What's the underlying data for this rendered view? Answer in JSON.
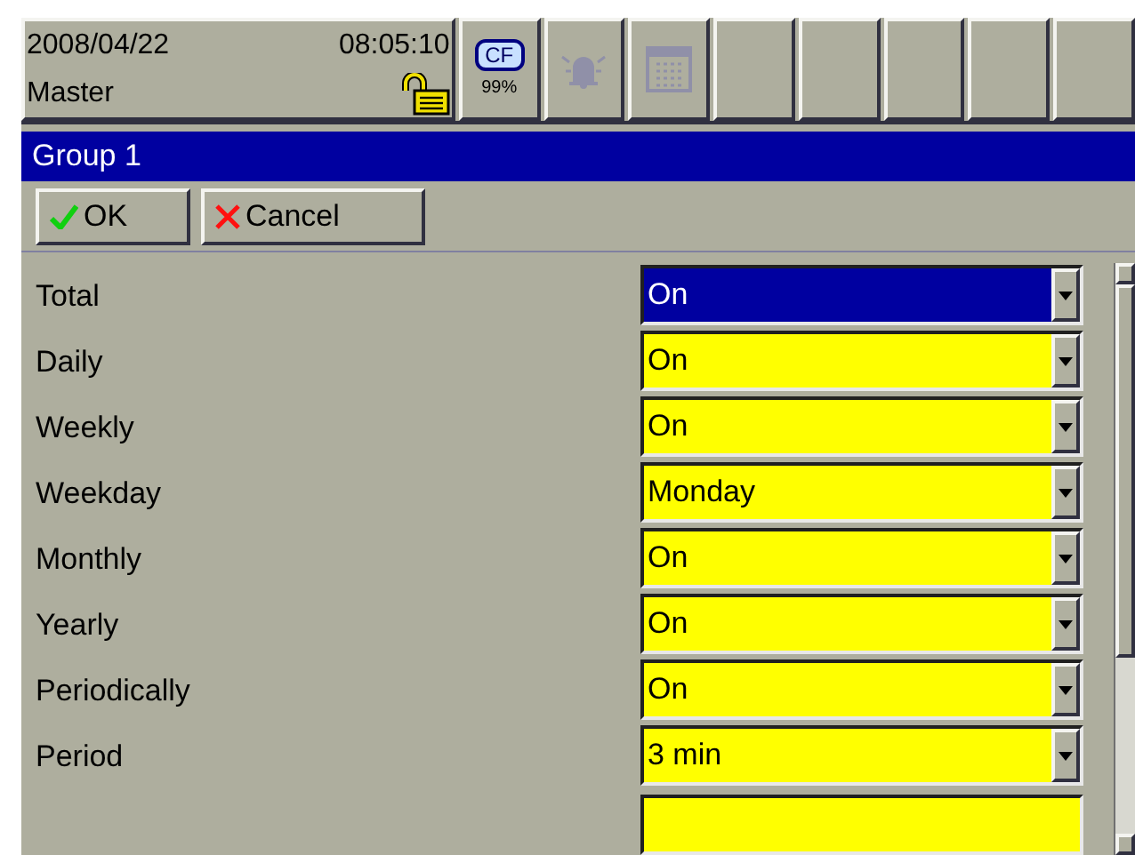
{
  "status_bar": {
    "date": "2008/04/22",
    "time": "08:05:10",
    "user": "Master",
    "locked": false,
    "card": {
      "label": "CF",
      "usage": "99%"
    },
    "alarm_active": false
  },
  "group": {
    "title": "Group 1"
  },
  "buttons": [
    {
      "kind": "ok",
      "label": "OK"
    },
    {
      "kind": "cancel",
      "label": "Cancel"
    }
  ],
  "rows": [
    {
      "label": "Total",
      "value": "On",
      "selected": true
    },
    {
      "label": "Daily",
      "value": "On",
      "selected": false
    },
    {
      "label": "Weekly",
      "value": "On",
      "selected": false
    },
    {
      "label": "Weekday",
      "value": "Monday",
      "selected": false
    },
    {
      "label": "Monthly",
      "value": "On",
      "selected": false
    },
    {
      "label": "Yearly",
      "value": "On",
      "selected": false
    },
    {
      "label": "Periodically",
      "value": "On",
      "selected": false
    },
    {
      "label": "Period",
      "value": "3 min",
      "selected": false
    }
  ]
}
